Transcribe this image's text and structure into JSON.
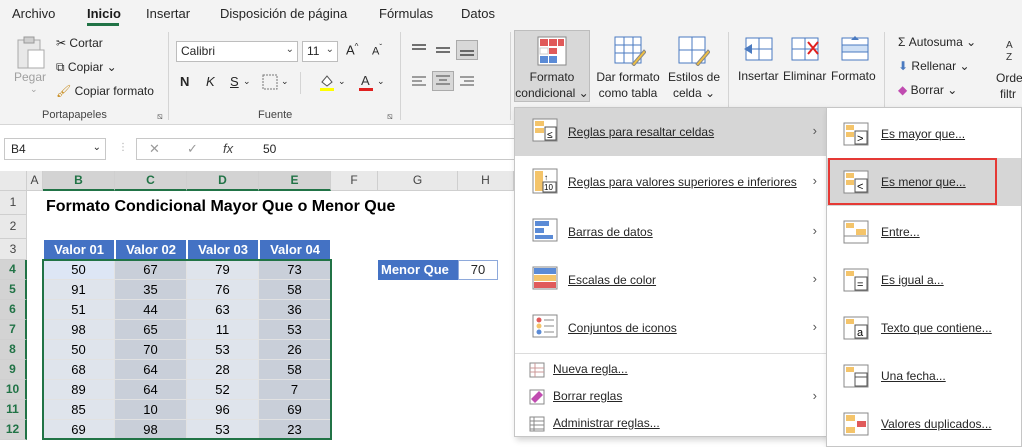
{
  "tabs": [
    "Archivo",
    "Inicio",
    "Insertar",
    "Disposición de página",
    "Fórmulas",
    "Datos"
  ],
  "ribbon": {
    "clipboard": {
      "paste": "Pegar",
      "cut": "Cortar",
      "copy": "Copiar",
      "format_painter": "Copiar formato",
      "group": "Portapapeles"
    },
    "font": {
      "name": "Calibri",
      "size": "11",
      "bold": "N",
      "italic": "K",
      "underline": "S",
      "group": "Fuente"
    },
    "styles": {
      "conditional_format_line1": "Formato",
      "conditional_format_line2": "condicional",
      "format_table_line1": "Dar formato",
      "format_table_line2": "como tabla",
      "cell_styles_line1": "Estilos de",
      "cell_styles_line2": "celda"
    },
    "cells": {
      "insert": "Insertar",
      "delete": "Eliminar",
      "format": "Formato"
    },
    "editing": {
      "autosum": "Autosuma",
      "fill": "Rellenar",
      "clear": "Borrar",
      "sort_line1": "Orde",
      "sort_line2": "filtr"
    }
  },
  "formula_bar": {
    "name_box": "B4",
    "cancel": "✕",
    "enter": "✓",
    "fx": "fx",
    "value": "50"
  },
  "grid": {
    "columns": [
      "A",
      "B",
      "C",
      "D",
      "E",
      "F",
      "G",
      "H"
    ],
    "rows": [
      "1",
      "2",
      "3",
      "4",
      "5",
      "6",
      "7",
      "8",
      "9",
      "10",
      "11",
      "12"
    ],
    "title": "Formato Condicional Mayor Que o Menor Que",
    "headers": [
      "Valor 01",
      "Valor 02",
      "Valor 03",
      "Valor 04"
    ],
    "data": [
      [
        "50",
        "67",
        "79",
        "73"
      ],
      [
        "91",
        "35",
        "76",
        "58"
      ],
      [
        "51",
        "44",
        "63",
        "36"
      ],
      [
        "98",
        "65",
        "11",
        "53"
      ],
      [
        "50",
        "70",
        "53",
        "26"
      ],
      [
        "68",
        "64",
        "28",
        "58"
      ],
      [
        "89",
        "64",
        "52",
        "7"
      ],
      [
        "85",
        "10",
        "96",
        "69"
      ],
      [
        "69",
        "98",
        "53",
        "23"
      ]
    ],
    "menor_que_label": "Menor Que",
    "menor_que_value": "70"
  },
  "menu1": {
    "items": [
      "Reglas para resaltar celdas",
      "Reglas para valores superiores e inferiores",
      "Barras de datos",
      "Escalas de color",
      "Conjuntos de iconos"
    ],
    "small_items": [
      "Nueva regla...",
      "Borrar reglas",
      "Administrar reglas..."
    ]
  },
  "menu2": {
    "items": [
      "Es mayor que...",
      "Es menor que...",
      "Entre...",
      "Es igual a...",
      "Texto que contiene...",
      "Una fecha...",
      "Valores duplicados..."
    ]
  },
  "colors": {
    "accent": "#217346",
    "header_blue": "#4472c4",
    "highlight_red": "#e53935"
  }
}
